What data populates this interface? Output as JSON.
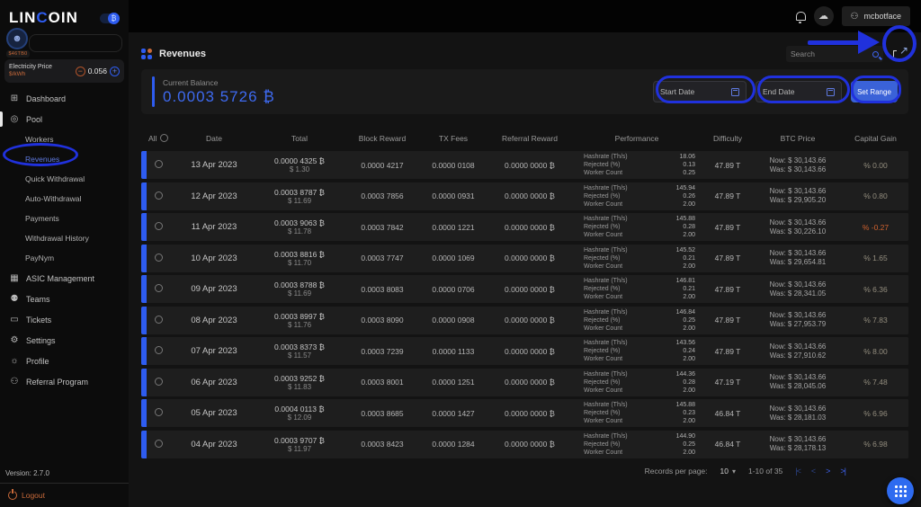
{
  "brand": {
    "logo_part1": "LIN",
    "logo_accent": "C",
    "logo_part2": "OIN",
    "toggle_glyph": "₿"
  },
  "sidebar": {
    "avatar_badge": "$46TB0",
    "electricity": {
      "label": "Electricity Price",
      "unit": "$/kWh",
      "value": "0.056",
      "minus": "−",
      "plus": "+"
    },
    "dashboard": "Dashboard",
    "pool": "Pool",
    "pool_items": [
      {
        "label": "Workers",
        "cls": ""
      },
      {
        "label": "Revenues",
        "cls": "active"
      },
      {
        "label": "Quick Withdrawal",
        "cls": ""
      },
      {
        "label": "Auto-Withdrawal",
        "cls": ""
      },
      {
        "label": "Payments",
        "cls": ""
      },
      {
        "label": "Withdrawal History",
        "cls": ""
      },
      {
        "label": "PayNym",
        "cls": ""
      }
    ],
    "tools": [
      "ASIC Management",
      "Teams",
      "Tickets",
      "Settings",
      "Profile",
      "Referral Program"
    ],
    "version": "Version: 2.7.0",
    "logout": "Logout"
  },
  "header": {
    "username": "mcbotface",
    "search_placeholder": "Search"
  },
  "page": {
    "title": "Revenues"
  },
  "balance": {
    "label": "Current Balance",
    "value": "0.0003 5726 ₿"
  },
  "filters": {
    "start_date": "Start Date",
    "end_date": "End Date",
    "set_range": "Set Range"
  },
  "glyphs": {
    "cloud": "☁",
    "user": "⚇",
    "export_arrow": "↗",
    "dashboard": "⊞",
    "pool": "◎",
    "asic": "▦",
    "teams": "⚉",
    "tickets": "▭",
    "settings": "⚙",
    "profile": "☼",
    "referral": "⚇"
  },
  "table": {
    "headers": {
      "all": "All",
      "date": "Date",
      "total": "Total",
      "block_reward": "Block Reward",
      "tx_fees": "TX Fees",
      "referral": "Referral Reward",
      "performance": "Performance",
      "difficulty": "Difficulty",
      "btc_price": "BTC Price",
      "capital_gain": "Capital Gain"
    },
    "perf_labels": [
      "Hashrate (Th/s)",
      "Rejected (%)",
      "Worker Count"
    ],
    "rows": [
      {
        "date": "13 Apr 2023",
        "total_btc": "0.0000 4325 ₿",
        "total_usd": "$ 1.30",
        "block_reward": "0.0000 4217",
        "tx_fees": "0.0000 0108",
        "referral": "0.0000 0000 ₿",
        "perf": [
          "18.06",
          "0.13",
          "0.25"
        ],
        "difficulty": "47.89 T",
        "btc_now": "Now:  $ 30,143.66",
        "btc_was": "Was:  $ 30,143.66",
        "gain": "% 0.00",
        "gain_cls": "pos"
      },
      {
        "date": "12 Apr 2023",
        "total_btc": "0.0003 8787 ₿",
        "total_usd": "$ 11.69",
        "block_reward": "0.0003 7856",
        "tx_fees": "0.0000 0931",
        "referral": "0.0000 0000 ₿",
        "perf": [
          "145.94",
          "0.26",
          "2.00"
        ],
        "difficulty": "47.89 T",
        "btc_now": "Now:  $ 30,143.66",
        "btc_was": "Was:  $ 29,905.20",
        "gain": "% 0.80",
        "gain_cls": "pos"
      },
      {
        "date": "11 Apr 2023",
        "total_btc": "0.0003 9063 ₿",
        "total_usd": "$ 11.78",
        "block_reward": "0.0003 7842",
        "tx_fees": "0.0000 1221",
        "referral": "0.0000 0000 ₿",
        "perf": [
          "145.88",
          "0.28",
          "2.00"
        ],
        "difficulty": "47.89 T",
        "btc_now": "Now:  $ 30,143.66",
        "btc_was": "Was:  $ 30,226.10",
        "gain": "% -0.27",
        "gain_cls": "neg"
      },
      {
        "date": "10 Apr 2023",
        "total_btc": "0.0003 8816 ₿",
        "total_usd": "$ 11.70",
        "block_reward": "0.0003 7747",
        "tx_fees": "0.0000 1069",
        "referral": "0.0000 0000 ₿",
        "perf": [
          "145.52",
          "0.21",
          "2.00"
        ],
        "difficulty": "47.89 T",
        "btc_now": "Now:  $ 30,143.66",
        "btc_was": "Was:  $ 29,654.81",
        "gain": "% 1.65",
        "gain_cls": "pos"
      },
      {
        "date": "09 Apr 2023",
        "total_btc": "0.0003 8788 ₿",
        "total_usd": "$ 11.69",
        "block_reward": "0.0003 8083",
        "tx_fees": "0.0000 0706",
        "referral": "0.0000 0000 ₿",
        "perf": [
          "146.81",
          "0.21",
          "2.00"
        ],
        "difficulty": "47.89 T",
        "btc_now": "Now:  $ 30,143.66",
        "btc_was": "Was:  $ 28,341.05",
        "gain": "% 6.36",
        "gain_cls": "pos"
      },
      {
        "date": "08 Apr 2023",
        "total_btc": "0.0003 8997 ₿",
        "total_usd": "$ 11.76",
        "block_reward": "0.0003 8090",
        "tx_fees": "0.0000 0908",
        "referral": "0.0000 0000 ₿",
        "perf": [
          "146.84",
          "0.25",
          "2.00"
        ],
        "difficulty": "47.89 T",
        "btc_now": "Now:  $ 30,143.66",
        "btc_was": "Was:  $ 27,953.79",
        "gain": "% 7.83",
        "gain_cls": "pos"
      },
      {
        "date": "07 Apr 2023",
        "total_btc": "0.0003 8373 ₿",
        "total_usd": "$ 11.57",
        "block_reward": "0.0003 7239",
        "tx_fees": "0.0000 1133",
        "referral": "0.0000 0000 ₿",
        "perf": [
          "143.56",
          "0.24",
          "2.00"
        ],
        "difficulty": "47.89 T",
        "btc_now": "Now:  $ 30,143.66",
        "btc_was": "Was:  $ 27,910.62",
        "gain": "% 8.00",
        "gain_cls": "pos"
      },
      {
        "date": "06 Apr 2023",
        "total_btc": "0.0003 9252 ₿",
        "total_usd": "$ 11.83",
        "block_reward": "0.0003 8001",
        "tx_fees": "0.0000 1251",
        "referral": "0.0000 0000 ₿",
        "perf": [
          "144.36",
          "0.28",
          "2.00"
        ],
        "difficulty": "47.19 T",
        "btc_now": "Now:  $ 30,143.66",
        "btc_was": "Was:  $ 28,045.06",
        "gain": "% 7.48",
        "gain_cls": "pos"
      },
      {
        "date": "05 Apr 2023",
        "total_btc": "0.0004 0113 ₿",
        "total_usd": "$ 12.09",
        "block_reward": "0.0003 8685",
        "tx_fees": "0.0000 1427",
        "referral": "0.0000 0000 ₿",
        "perf": [
          "145.88",
          "0.23",
          "2.00"
        ],
        "difficulty": "46.84 T",
        "btc_now": "Now:  $ 30,143.66",
        "btc_was": "Was:  $ 28,181.03",
        "gain": "% 6.96",
        "gain_cls": "pos"
      },
      {
        "date": "04 Apr 2023",
        "total_btc": "0.0003 9707 ₿",
        "total_usd": "$ 11.97",
        "block_reward": "0.0003 8423",
        "tx_fees": "0.0000 1284",
        "referral": "0.0000 0000 ₿",
        "perf": [
          "144.90",
          "0.25",
          "2.00"
        ],
        "difficulty": "46.84 T",
        "btc_now": "Now:  $ 30,143.66",
        "btc_was": "Was:  $ 28,178.13",
        "gain": "% 6.98",
        "gain_cls": "pos"
      }
    ]
  },
  "footer": {
    "records_label": "Records per page:",
    "records_value": "10",
    "caret": "▾",
    "range": "1-10 of 35",
    "pager": [
      "|<",
      "<",
      ">",
      ">|"
    ]
  }
}
